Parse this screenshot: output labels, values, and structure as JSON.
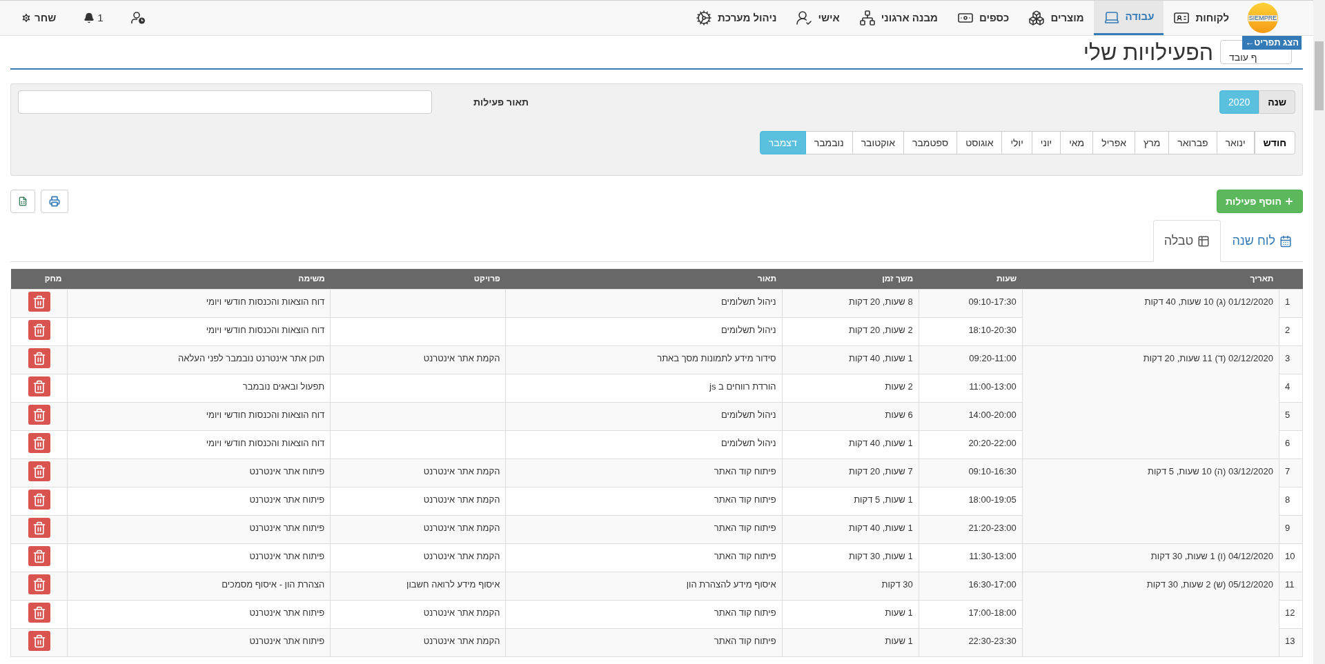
{
  "logo": {
    "text": "SIEMPRE"
  },
  "nav": {
    "items": [
      {
        "label": "לקוחות",
        "selected": false
      },
      {
        "label": "עבודה",
        "selected": true
      },
      {
        "label": "מוצרים",
        "selected": false
      },
      {
        "label": "כספים",
        "selected": false
      },
      {
        "label": "מבנה ארגוני",
        "selected": false
      },
      {
        "label": "אישי",
        "selected": false
      },
      {
        "label": "ניהול מערכת",
        "selected": false
      }
    ],
    "user": {
      "name": "שחר"
    },
    "notifications": {
      "count": "1"
    }
  },
  "menu_tooltip": "הצג תפריט←",
  "page": {
    "title": "הפעילויות שלי",
    "employee_button": "ף עובד"
  },
  "filters": {
    "year_label": "שנה",
    "years": [
      {
        "label": "2020",
        "selected": true
      }
    ],
    "month_label": "חודש",
    "months": [
      {
        "label": "ינואר",
        "selected": false
      },
      {
        "label": "פברואר",
        "selected": false
      },
      {
        "label": "מרץ",
        "selected": false
      },
      {
        "label": "אפריל",
        "selected": false
      },
      {
        "label": "מאי",
        "selected": false
      },
      {
        "label": "יוני",
        "selected": false
      },
      {
        "label": "יולי",
        "selected": false
      },
      {
        "label": "אוגוסט",
        "selected": false
      },
      {
        "label": "ספטמבר",
        "selected": false
      },
      {
        "label": "אוקטובר",
        "selected": false
      },
      {
        "label": "נובמבר",
        "selected": false
      },
      {
        "label": "דצמבר",
        "selected": true
      }
    ],
    "description_label": "תאור פעילות"
  },
  "add_button": "הוסף פעילות",
  "tabs": [
    {
      "label": "לוח שנה",
      "selected": false
    },
    {
      "label": "טבלה",
      "selected": true
    }
  ],
  "table": {
    "columns": [
      "תאריך",
      "שעות",
      "משך זמן",
      "תאור",
      "פרויקט",
      "משימה",
      "מחק"
    ],
    "groups": [
      {
        "date": "01/12/2020 (ג) 10 שעות, 40 דקות",
        "rows": [
          {
            "num": "1",
            "hours": "09:10-17:30",
            "duration": "8 שעות, 20 דקות",
            "description": "ניהול תשלומים",
            "task": "דוח הוצאות והכנסות חודשי ויומי"
          },
          {
            "num": "2",
            "hours": "18:10-20:30",
            "duration": "2 שעות, 20 דקות",
            "description": "ניהול תשלומים",
            "task": "דוח הוצאות והכנסות חודשי ויומי"
          }
        ]
      },
      {
        "date": "02/12/2020 (ד) 11 שעות, 20 דקות",
        "rows": [
          {
            "num": "3",
            "hours": "09:20-11:00",
            "duration": "1 שעות, 40 דקות",
            "description": "סידור מידע לתמונות מסך באתר",
            "project": "הקמת אתר אינטרנט",
            "task": "תוכן אתר אינטרנט נובמבר לפני העלאה"
          },
          {
            "num": "4",
            "hours": "11:00-13:00",
            "duration": "2 שעות",
            "description": "הורדת רווחים ב js",
            "task": "תפעול ובאגים נובמבר"
          },
          {
            "num": "5",
            "hours": "14:00-20:00",
            "duration": "6 שעות",
            "description": "ניהול תשלומים",
            "task": "דוח הוצאות והכנסות חודשי ויומי"
          },
          {
            "num": "6",
            "hours": "20:20-22:00",
            "duration": "1 שעות, 40 דקות",
            "description": "ניהול תשלומים",
            "task": "דוח הוצאות והכנסות חודשי ויומי"
          }
        ]
      },
      {
        "date": "03/12/2020 (ה) 10 שעות, 5 דקות",
        "rows": [
          {
            "num": "7",
            "hours": "09:10-16:30",
            "duration": "7 שעות, 20 דקות",
            "description": "פיתוח קוד האתר",
            "project": "הקמת אתר אינטרנט",
            "task": "פיתוח אתר אינטרנט"
          },
          {
            "num": "8",
            "hours": "18:00-19:05",
            "duration": "1 שעות, 5 דקות",
            "description": "פיתוח קוד האתר",
            "project": "הקמת אתר אינטרנט",
            "task": "פיתוח אתר אינטרנט"
          },
          {
            "num": "9",
            "hours": "21:20-23:00",
            "duration": "1 שעות, 40 דקות",
            "description": "פיתוח קוד האתר",
            "project": "הקמת אתר אינטרנט",
            "task": "פיתוח אתר אינטרנט"
          }
        ]
      },
      {
        "date": "04/12/2020 (ו) 1 שעות, 30 דקות",
        "rows": [
          {
            "num": "10",
            "hours": "11:30-13:00",
            "duration": "1 שעות, 30 דקות",
            "description": "פיתוח קוד האתר",
            "project": "הקמת אתר אינטרנט",
            "task": "פיתוח אתר אינטרנט"
          }
        ]
      },
      {
        "date": "05/12/2020 (ש) 2 שעות, 30 דקות",
        "rows": [
          {
            "num": "11",
            "hours": "16:30-17:00",
            "duration": "30 דקות",
            "description": "איסוף מידע להצהרת הון",
            "project": "איסוף מידע לרואה חשבון",
            "task": "הצהרת הון - איסוף מסמכים"
          },
          {
            "num": "12",
            "hours": "17:00-18:00",
            "duration": "1 שעות",
            "description": "פיתוח קוד האתר",
            "project": "הקמת אתר אינטרנט",
            "task": "פיתוח אתר אינטרנט"
          },
          {
            "num": "13",
            "hours": "22:30-23:30",
            "duration": "1 שעות",
            "description": "פיתוח קוד האתר",
            "project": "הקמת אתר אינטרנט",
            "task": "פיתוח אתר אינטרנט"
          }
        ]
      }
    ]
  }
}
